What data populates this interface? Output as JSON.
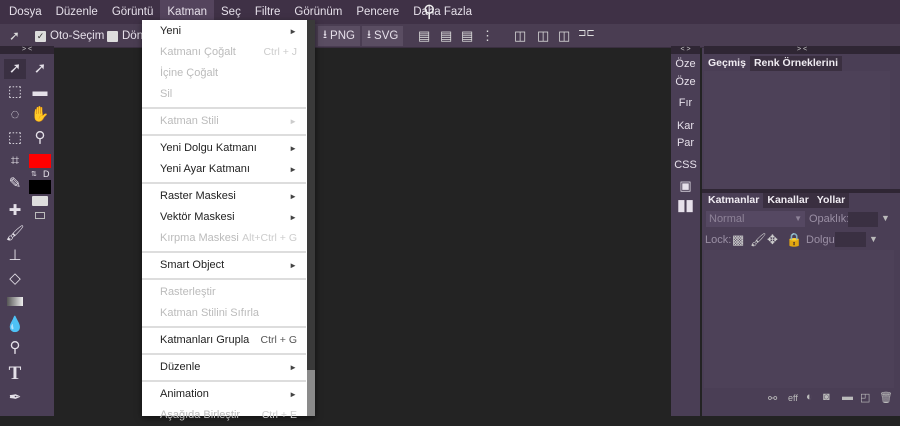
{
  "menubar": [
    "Dosya",
    "Düzenle",
    "Görüntü",
    "Katman",
    "Seç",
    "Filtre",
    "Görünüm",
    "Pencere",
    "Daha Fazla"
  ],
  "toolbar": {
    "auto_select": "Oto-Seçim",
    "transform": "Dönü",
    "png": "PNG",
    "svg": "SVG"
  },
  "menu": [
    {
      "label": "Yeni",
      "arrow": "►",
      "enabled": true
    },
    {
      "label": "Katmanı Çoğalt",
      "shortcut": "Ctrl + J",
      "enabled": false
    },
    {
      "label": "İçine Çoğalt",
      "enabled": false
    },
    {
      "label": "Sil",
      "enabled": false
    },
    {
      "sep": true
    },
    {
      "label": "Katman Stili",
      "arrow": "►",
      "enabled": false
    },
    {
      "sep": true
    },
    {
      "label": "Yeni Dolgu Katmanı",
      "arrow": "►",
      "enabled": true
    },
    {
      "label": "Yeni Ayar Katmanı",
      "arrow": "►",
      "enabled": true
    },
    {
      "sep": true
    },
    {
      "label": "Raster Maskesi",
      "arrow": "►",
      "enabled": true
    },
    {
      "label": "Vektör Maskesi",
      "arrow": "►",
      "enabled": true
    },
    {
      "label": "Kırpma Maskesi",
      "shortcut": "Alt+Ctrl + G",
      "enabled": false
    },
    {
      "sep": true
    },
    {
      "label": "Smart Object",
      "arrow": "►",
      "enabled": true
    },
    {
      "sep": true
    },
    {
      "label": "Rasterleştir",
      "enabled": false
    },
    {
      "label": "Katman Stilini Sıfırla",
      "enabled": false
    },
    {
      "sep": true
    },
    {
      "label": "Katmanları Grupla",
      "shortcut": "Ctrl + G",
      "enabled": true
    },
    {
      "sep": true
    },
    {
      "label": "Düzenle",
      "arrow": "►",
      "enabled": true
    },
    {
      "sep": true
    },
    {
      "label": "Animation",
      "arrow": "►",
      "enabled": true
    },
    {
      "label": "Aşağıda Birleştir",
      "shortcut": "Ctrl + E",
      "enabled": false
    }
  ],
  "colors": {
    "foreground": "#ff0000",
    "background": "#000000"
  },
  "swap_label": "D",
  "collapse_left": "> <",
  "collapse_mid": "< >",
  "collapse_right": "> <",
  "right_column": [
    "Öze",
    "Öze",
    "Fır",
    "Kar",
    "Par",
    "CSS"
  ],
  "history_panel": {
    "tabs": [
      "Geçmiş",
      "Renk Örneklerini"
    ]
  },
  "layers_panel": {
    "tabs": [
      "Katmanlar",
      "Kanallar",
      "Yollar"
    ],
    "blend_mode": "Normal",
    "opacity_label": "Opaklık:",
    "lock_label": "Lock:",
    "fill_label": "Dolgu:",
    "eff": "eff"
  }
}
